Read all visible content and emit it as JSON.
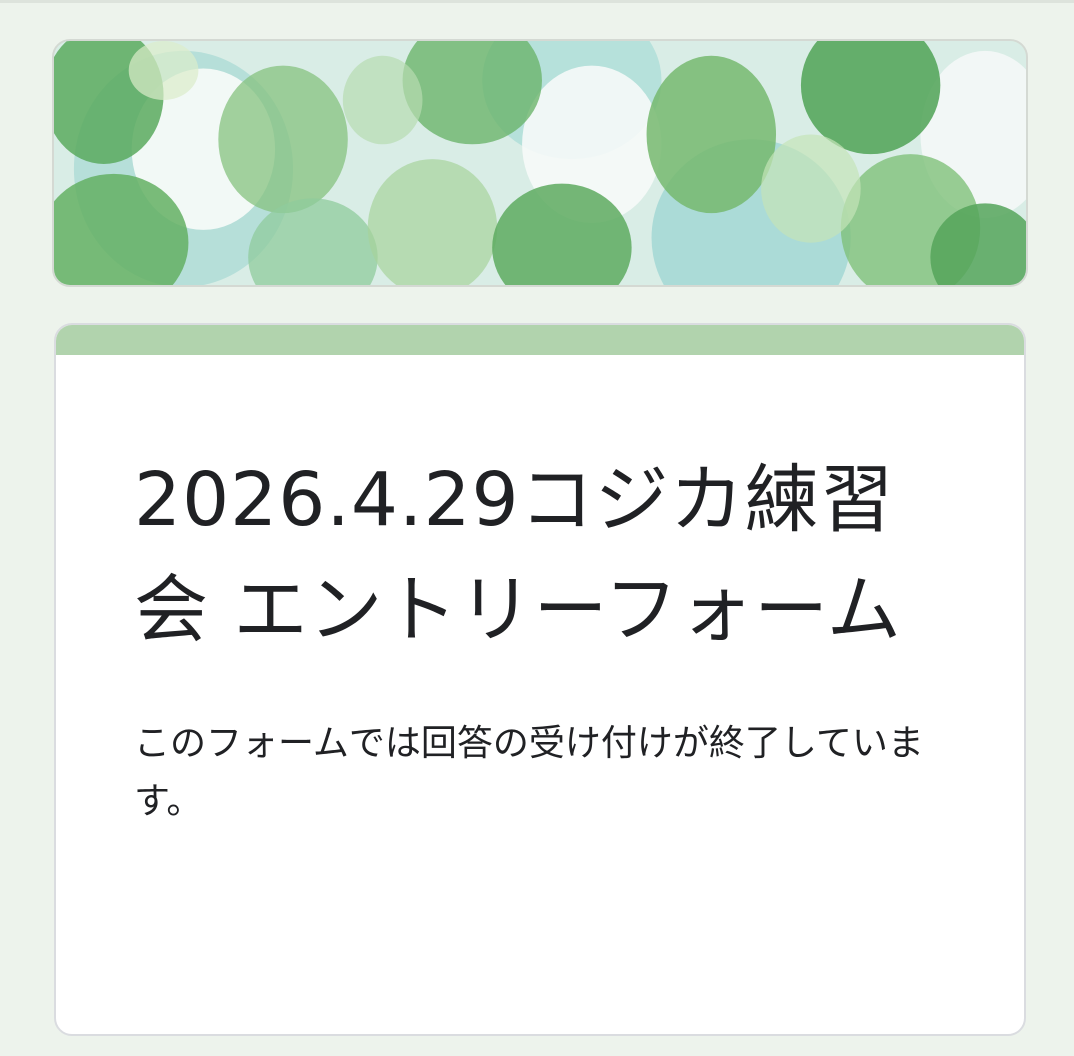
{
  "form": {
    "title": "2026.4.29コジカ練習会 エントリーフォーム",
    "closed_message": "このフォームでは回答の受け付けが終了しています。"
  },
  "theme": {
    "background": "#edf3ec",
    "accent": "#b1d3ad",
    "card": "#ffffff",
    "text": "#202124"
  },
  "header_image": {
    "description_icon": "balloon-pattern"
  }
}
